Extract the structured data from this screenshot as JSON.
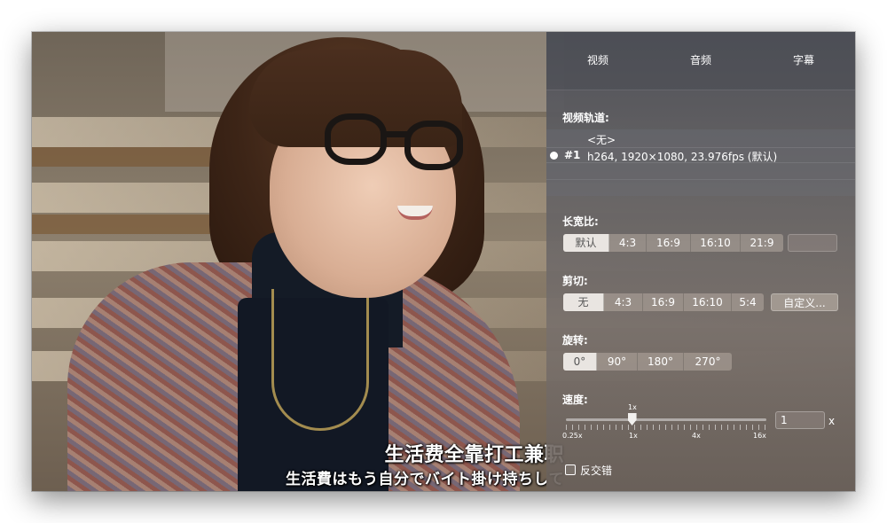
{
  "tabs": [
    "视频",
    "音频",
    "字幕"
  ],
  "video_track": {
    "label": "视频轨道:",
    "options": [
      {
        "num": "",
        "text": "<无>",
        "selected": false
      },
      {
        "num": "#1",
        "text": "h264, 1920×1080, 23.976fps (默认)",
        "selected": true
      }
    ]
  },
  "aspect": {
    "label": "长宽比:",
    "options": [
      "默认",
      "4:3",
      "16:9",
      "16:10",
      "21:9"
    ],
    "selected": "默认"
  },
  "crop": {
    "label": "剪切:",
    "options": [
      "无",
      "4:3",
      "16:9",
      "16:10",
      "5:4"
    ],
    "selected": "无",
    "custom_label": "自定义..."
  },
  "rotate": {
    "label": "旋转:",
    "options": [
      "0°",
      "90°",
      "180°",
      "270°"
    ],
    "selected": "0°"
  },
  "speed": {
    "label": "速度:",
    "current_label": "1x",
    "tick_labels": [
      "0.25x",
      "1x",
      "4x",
      "16x"
    ],
    "value": "1",
    "unit": "x",
    "slider_fraction": 0.33
  },
  "deinterlace": {
    "label": "反交错",
    "checked": false
  },
  "subtitles": {
    "zh": "生活费全靠打工兼职",
    "ja": "生活費はもう自分でバイト掛け持ちして"
  }
}
